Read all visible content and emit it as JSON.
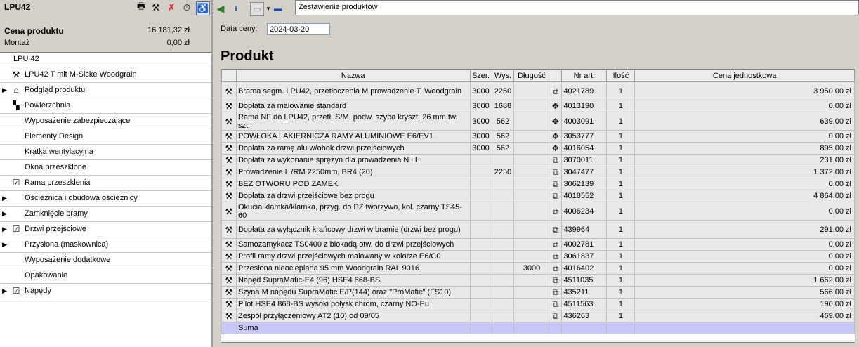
{
  "left": {
    "title": "LPU42",
    "price_label": "Cena produktu",
    "price_value": "16 181,32 zł",
    "montaz_label": "Montaż",
    "montaz_value": "0,00 zł",
    "tree": [
      {
        "label": "LPU 42",
        "indent": 19,
        "arrow": false,
        "icon": ""
      },
      {
        "label": "LPU42 T mit M-Sicke Woodgrain",
        "indent": 35,
        "arrow": false,
        "icon": "hammer-icon"
      },
      {
        "label": "Podgląd produktu",
        "indent": 35,
        "arrow": true,
        "icon": "preview-icon"
      },
      {
        "label": "Powierzchnia",
        "indent": 35,
        "arrow": false,
        "icon": "surface-icon"
      },
      {
        "label": "Wyposażenie zabezpieczające",
        "indent": 35,
        "arrow": false,
        "icon": ""
      },
      {
        "label": "Elementy Design",
        "indent": 35,
        "arrow": false,
        "icon": ""
      },
      {
        "label": "Kratka wentylacyjna",
        "indent": 35,
        "arrow": false,
        "icon": ""
      },
      {
        "label": "Okna przeszklone",
        "indent": 35,
        "arrow": false,
        "icon": ""
      },
      {
        "label": "Rama przeszklenia",
        "indent": 35,
        "arrow": false,
        "icon": "check-icon"
      },
      {
        "label": "Ościeżnica i obudowa ościeżnicy",
        "indent": 35,
        "arrow": true,
        "icon": ""
      },
      {
        "label": "Zamknięcie bramy",
        "indent": 35,
        "arrow": true,
        "icon": ""
      },
      {
        "label": "Drzwi przejściowe",
        "indent": 35,
        "arrow": true,
        "icon": "check-icon"
      },
      {
        "label": "Przysłona (maskownica)",
        "indent": 35,
        "arrow": true,
        "icon": ""
      },
      {
        "label": "Wyposażenie dodatkowe",
        "indent": 35,
        "arrow": false,
        "icon": ""
      },
      {
        "label": "Opakowanie",
        "indent": 35,
        "arrow": false,
        "icon": ""
      },
      {
        "label": "Napędy",
        "indent": 35,
        "arrow": true,
        "icon": "check-icon"
      }
    ]
  },
  "right": {
    "tab_title": "Zestawienie produktów",
    "date_label": "Data ceny:",
    "date_value": "2024-03-20",
    "section_title": "Produkt",
    "columns": [
      "",
      "Nazwa",
      "Szer.",
      "Wys.",
      "Długość",
      "",
      "Nr art.",
      "Ilość",
      "Cena jednostkowa"
    ],
    "rows": [
      {
        "name": "Brama segm. LPU42, przetłoczenia M prowadzenie T, Woodgrain",
        "szer": "3000",
        "wys": "2250",
        "dl": "",
        "icon": "link-icon",
        "nr": "4021789",
        "ilosc": "1",
        "cena": "3 950,00 zł"
      },
      {
        "name": "Dopłata za malowanie standard",
        "szer": "3000",
        "wys": "1688",
        "dl": "",
        "icon": "move-icon",
        "nr": "4013190",
        "ilosc": "1",
        "cena": "0,00 zł"
      },
      {
        "name": "Rama NF do LPU42, przetł. S/M, podw. szyba kryszt. 26 mm tw. szt.",
        "szer": "3000",
        "wys": "562",
        "dl": "",
        "icon": "move-icon",
        "nr": "4003091",
        "ilosc": "1",
        "cena": "639,00 zł"
      },
      {
        "name": "POWŁOKA LAKIERNICZA RAMY ALUMINIOWE E6/EV1",
        "szer": "3000",
        "wys": "562",
        "dl": "",
        "icon": "move-icon",
        "nr": "3053777",
        "ilosc": "1",
        "cena": "0,00 zł"
      },
      {
        "name": "Dopłata za ramę alu w/obok drzwi przejściowych",
        "szer": "3000",
        "wys": "562",
        "dl": "",
        "icon": "move-icon",
        "nr": "4016054",
        "ilosc": "1",
        "cena": "895,00 zł"
      },
      {
        "name": "Dopłata za wykonanie sprężyn dla prowadzenia N i L",
        "szer": "",
        "wys": "",
        "dl": "",
        "icon": "link-icon",
        "nr": "3070011",
        "ilosc": "1",
        "cena": "231,00 zł"
      },
      {
        "name": "Prowadzenie L /RM 2250mm, BR4 (20)",
        "szer": "",
        "wys": "2250",
        "dl": "",
        "icon": "link-icon",
        "nr": "3047477",
        "ilosc": "1",
        "cena": "1 372,00 zł"
      },
      {
        "name": "BEZ OTWORU POD ZAMEK",
        "szer": "",
        "wys": "",
        "dl": "",
        "icon": "link-icon",
        "nr": "3062139",
        "ilosc": "1",
        "cena": "0,00 zł"
      },
      {
        "name": "Dopłata za drzwi przejściowe bez progu",
        "szer": "",
        "wys": "",
        "dl": "",
        "icon": "link-icon",
        "nr": "4018552",
        "ilosc": "1",
        "cena": "4 864,00 zł"
      },
      {
        "name": "Okucia klamka/klamka, przyg. do PZ tworzywo, kol. czarny TS45-60",
        "szer": "",
        "wys": "",
        "dl": "",
        "icon": "link-icon",
        "nr": "4006234",
        "ilosc": "1",
        "cena": "0,00 zł"
      },
      {
        "name": "Dopłata za wyłącznik krańcowy drzwi w bramie (drzwi bez progu)",
        "szer": "",
        "wys": "",
        "dl": "",
        "icon": "link-icon",
        "nr": "439964",
        "ilosc": "1",
        "cena": "291,00 zł"
      },
      {
        "name": "Samozamykacz TS0400 z blokadą otw. do drzwi przejściowych",
        "szer": "",
        "wys": "",
        "dl": "",
        "icon": "link-icon",
        "nr": "4002781",
        "ilosc": "1",
        "cena": "0,00 zł"
      },
      {
        "name": "Profil ramy drzwi przejściowych malowany w kolorze E6/C0",
        "szer": "",
        "wys": "",
        "dl": "",
        "icon": "link-icon",
        "nr": "3061837",
        "ilosc": "1",
        "cena": "0,00 zł"
      },
      {
        "name": "Przesłona nieocieplana 95 mm Woodgrain RAL 9016",
        "szer": "",
        "wys": "",
        "dl": "3000",
        "icon": "link-icon",
        "nr": "4016402",
        "ilosc": "1",
        "cena": "0,00 zł"
      },
      {
        "name": "Napęd SupraMatic-E4 (96) HSE4 868-BS",
        "szer": "",
        "wys": "",
        "dl": "",
        "icon": "link-icon",
        "nr": "4511035",
        "ilosc": "1",
        "cena": "1 662,00 zł"
      },
      {
        "name": "Szyna M napędu SupraMatic E/P(144) oraz \"ProMatic\" (FS10)",
        "szer": "",
        "wys": "",
        "dl": "",
        "icon": "link-icon",
        "nr": "435211",
        "ilosc": "1",
        "cena": "566,00 zł"
      },
      {
        "name": "Pilot HSE4 868-BS wysoki połysk chrom, czarny NO-Eu",
        "szer": "",
        "wys": "",
        "dl": "",
        "icon": "link-icon",
        "nr": "4511563",
        "ilosc": "1",
        "cena": "190,00 zł"
      },
      {
        "name": "Zespół przyłączeniowy AT2      (10) od 09/05",
        "szer": "",
        "wys": "",
        "dl": "",
        "icon": "link-icon",
        "nr": "436263",
        "ilosc": "1",
        "cena": "469,00 zł"
      }
    ],
    "sum_label": "Suma"
  },
  "colors": {
    "accent": "#2a7a2a",
    "sum_row": "#c8c8f8",
    "panel": "#d4d0c8"
  }
}
